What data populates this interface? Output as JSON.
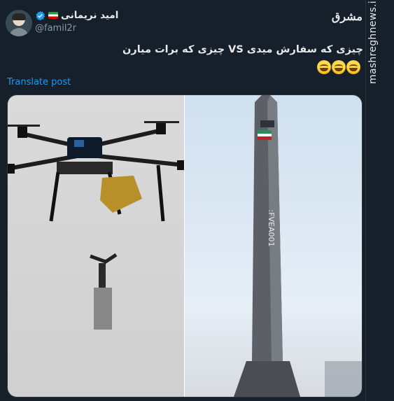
{
  "author": {
    "display_name": "امید نریمانی",
    "handle": "@famil2r"
  },
  "tweet": {
    "text": "چیزی که سفارش میدی VS چیزی که برات میارن",
    "translate_label": "Translate post"
  },
  "watermark": {
    "logo_text": "مشرق",
    "site": "mashreghnews.ir"
  },
  "media": {
    "rocket_marking": ":FVEA001"
  },
  "colors": {
    "background": "#15202b",
    "link": "#1d9bf0",
    "verified": "#1d9bf0"
  }
}
